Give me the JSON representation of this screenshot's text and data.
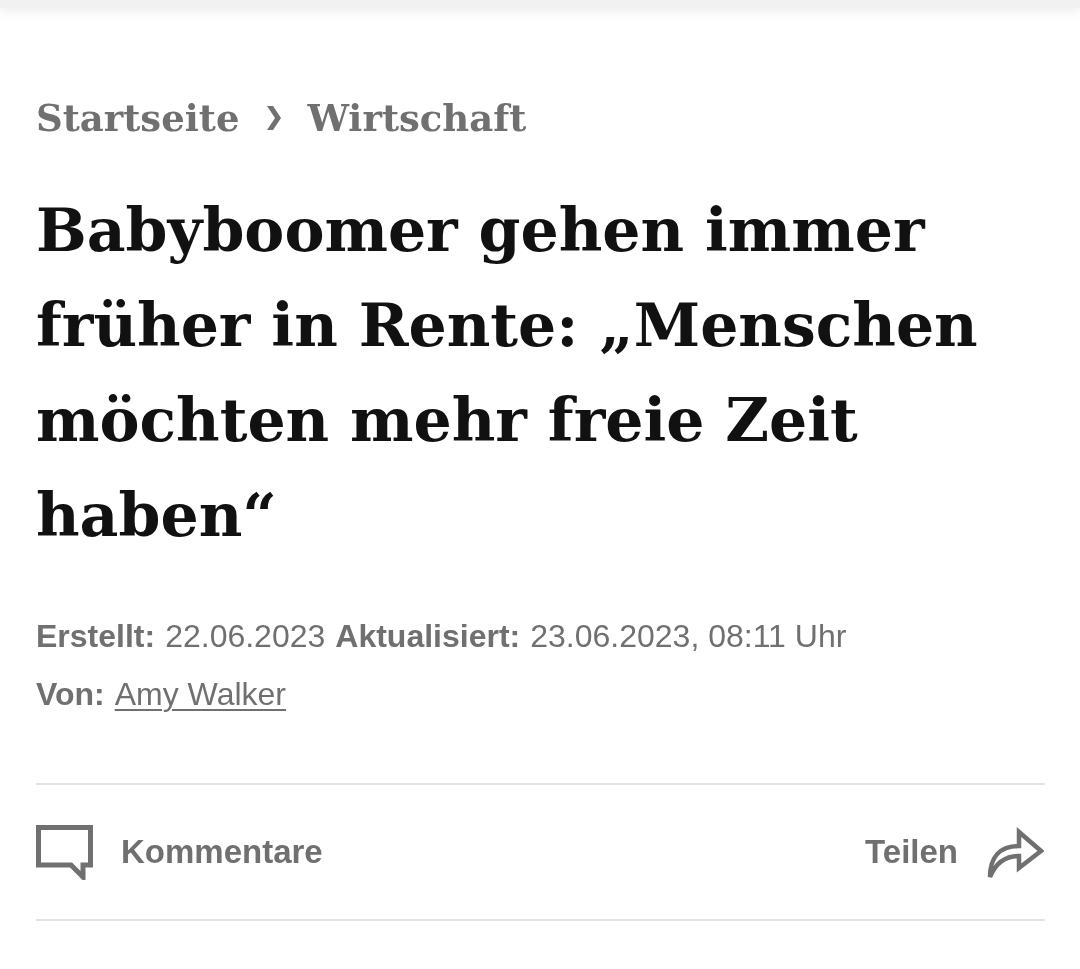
{
  "breadcrumb": [
    {
      "label": "Startseite"
    },
    {
      "label": "Wirtschaft"
    }
  ],
  "headline": "Babyboomer gehen immer früher in Rente: „Menschen möchten mehr freie Zeit haben“",
  "meta": {
    "dates": [
      {
        "label": "Erstellt:",
        "value": "22.06.2023"
      },
      {
        "label": "Aktualisiert:",
        "value": "23.06.2023, 08:11 Uhr"
      }
    ],
    "author": {
      "label": "Von:",
      "name": "Amy Walker"
    }
  },
  "actions": [
    {
      "kind": "comments",
      "label": "Kommentare"
    },
    {
      "kind": "share",
      "label": "Teilen"
    }
  ]
}
